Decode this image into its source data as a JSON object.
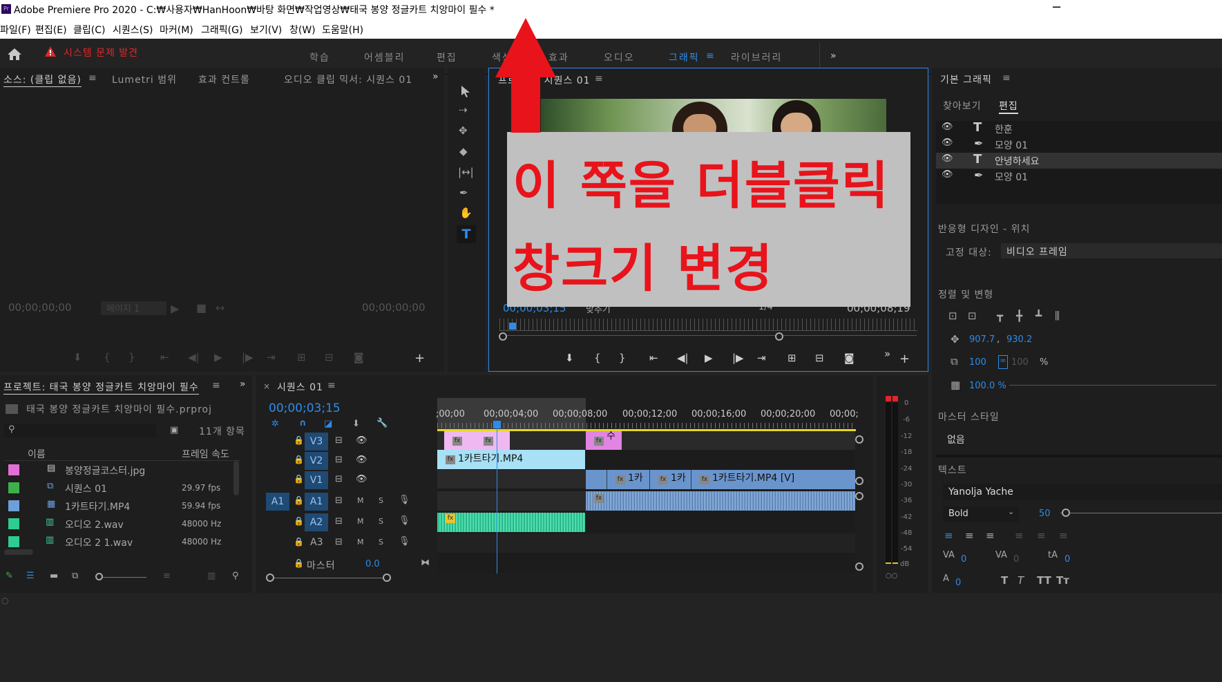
{
  "app_title": "Adobe Premiere Pro 2020 - C:₩사용자₩HanHoon₩바탕 화면₩작업영상₩태국 봉양 정글카트 치앙마이 필수 *",
  "menu": [
    "파일(F)",
    "편집(E)",
    "클립(C)",
    "시퀀스(S)",
    "마커(M)",
    "그래픽(G)",
    "보기(V)",
    "창(W)",
    "도움말(H)"
  ],
  "warning": "시스템 문제 발견",
  "workspaces": [
    "학습",
    "어셈블리",
    "편집",
    "색상",
    "효과",
    "오디오",
    "그래픽",
    "라이브러리"
  ],
  "active_workspace": "그래픽",
  "source_panel": {
    "tabs": [
      "소스: (클립 없음)",
      "Lumetri 범위",
      "효과 컨트롤",
      "오디오 클립 믹서: 시퀀스 01"
    ],
    "tc_left": "00;00;00;00",
    "tc_right": "00;00;00;00",
    "page": "페이지 1"
  },
  "program_panel": {
    "title": "프로그램: 시퀀스 01",
    "tc_left": "00;00;03;15",
    "fit": "맞추기",
    "res": "1/4",
    "tc_right": "00;00;08;19"
  },
  "annotation": {
    "line1": "이 쪽을 더블클릭",
    "line2": "창크기 변경",
    "arrow_color": "#e8131b"
  },
  "project": {
    "tab": "프로젝트: 태국 봉양 정글카트 치앙마이 필수",
    "file": "태국 봉양 정글카트 치앙마이 필수.prproj",
    "count": "11개 항목",
    "col_name": "이름",
    "col_rate": "프레임 속도",
    "items": [
      {
        "name": "봉양정글코스터.jpg",
        "rate": "",
        "color": "#e36fd6"
      },
      {
        "name": "시퀀스 01",
        "rate": "29.97 fps",
        "color": "#3db04b"
      },
      {
        "name": "1카트타기.MP4",
        "rate": "59.94 fps",
        "color": "#6e9fd8"
      },
      {
        "name": "오디오 2.wav",
        "rate": "48000 Hz",
        "color": "#2ecc8f"
      },
      {
        "name": "오디오 2  1.wav",
        "rate": "48000 Hz",
        "color": "#2ecc8f"
      }
    ]
  },
  "timeline": {
    "tab": "시퀀스 01",
    "timecode": "00;00;03;15",
    "ruler": [
      ";00;00",
      "00;00;04;00",
      "00;00;08;00",
      "00;00;12;00",
      "00;00;16;00",
      "00;00;20;00",
      "00;00;"
    ],
    "tracks_v": [
      "V3",
      "V2",
      "V1"
    ],
    "tracks_a": [
      "A1",
      "A2",
      "A3"
    ],
    "master": "마스터",
    "master_val": "0.0",
    "src_a1": "A1",
    "clip_v2": "1카트타기.MP4",
    "clip_v1a": "1카",
    "clip_v1b": "1카",
    "clip_v1c": "1카트타기.MP4 [V]",
    "clip_v3": "수"
  },
  "meter": [
    "0",
    "-6",
    "-12",
    "-18",
    "-24",
    "-30",
    "-36",
    "-42",
    "-48",
    "-54",
    "dB"
  ],
  "eg": {
    "title": "기본 그래픽",
    "tab_browse": "찾아보기",
    "tab_edit": "편집",
    "layers": [
      "한훈",
      "모양 01",
      "안녕하세요",
      "모양 01"
    ],
    "responsive": "반응형 디자인 - 위치",
    "pin_label": "고정 대상:",
    "pin_value": "비디오 프레임",
    "align": "정렬 및 변형",
    "pos_x": "907.7",
    "pos_y": "930.2",
    "scale": "100",
    "scale2": "100",
    "pct": "%",
    "opacity": "100.0 %",
    "master_style": "마스터 스타일",
    "style_none": "없음",
    "text_label": "텍스트",
    "font": "Yanolja Yache",
    "weight": "Bold",
    "size": "50",
    "zero": "0"
  }
}
